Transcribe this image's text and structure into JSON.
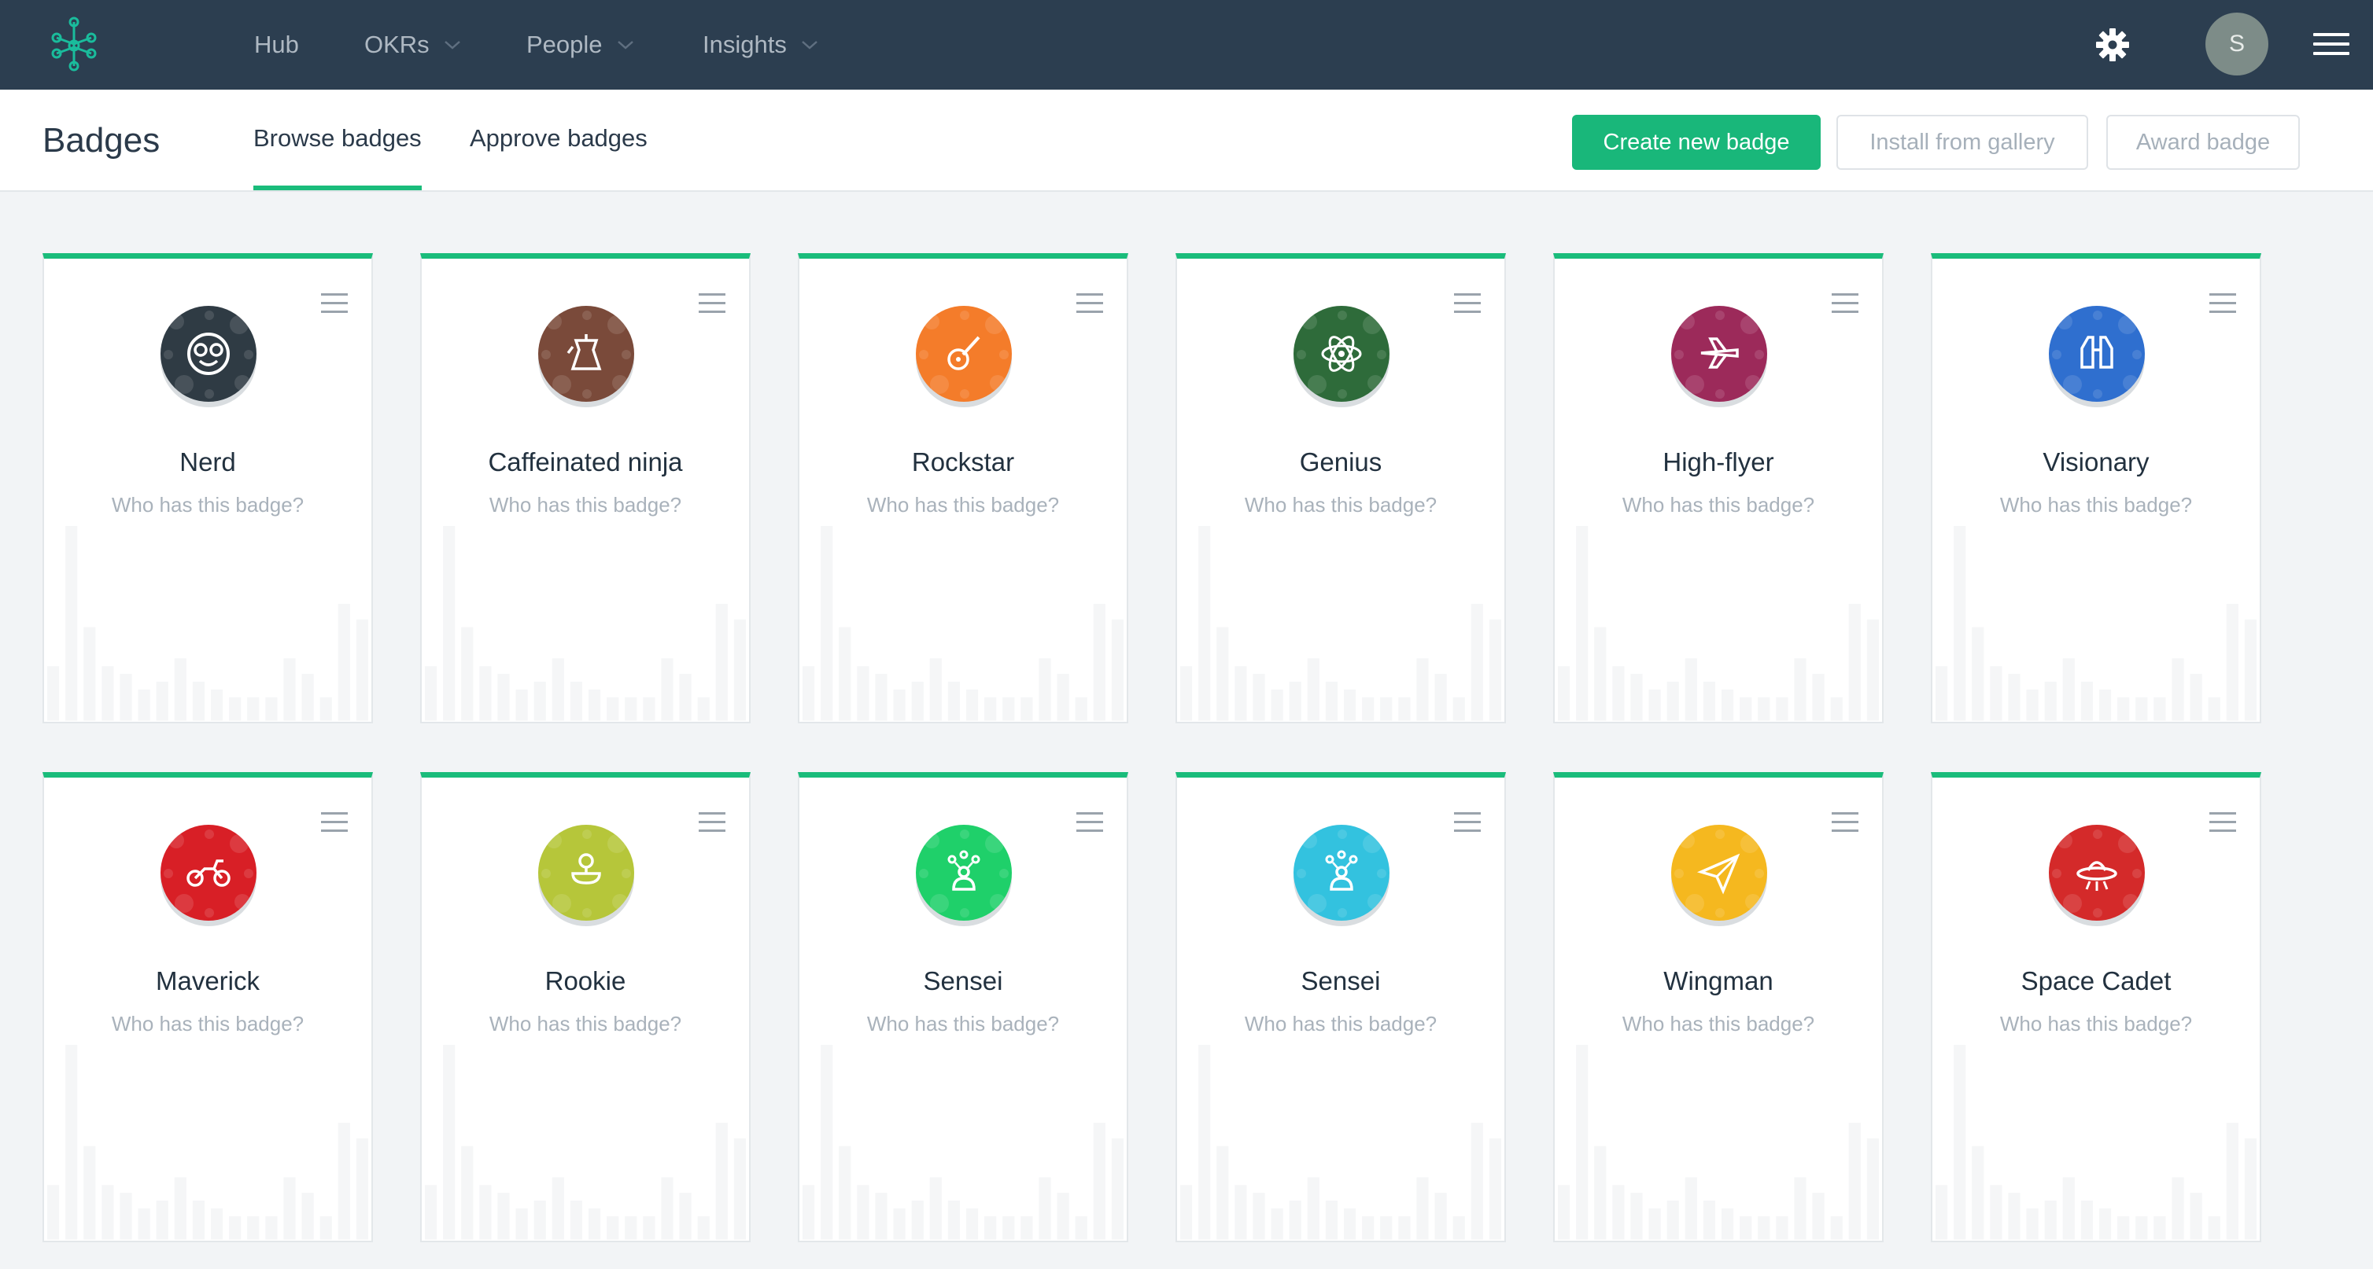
{
  "nav": {
    "items": [
      {
        "label": "Hub",
        "dropdown": false
      },
      {
        "label": "OKRs",
        "dropdown": true
      },
      {
        "label": "People",
        "dropdown": true
      },
      {
        "label": "Insights",
        "dropdown": true
      }
    ],
    "avatar_initial": "S",
    "icons": {
      "logo": "network-logo-icon",
      "settings": "gear-icon",
      "menu": "hamburger-icon"
    }
  },
  "subheader": {
    "title": "Badges",
    "tabs": [
      {
        "label": "Browse badges",
        "active": true
      },
      {
        "label": "Approve badges",
        "active": false
      }
    ],
    "buttons": {
      "create": "Create new badge",
      "install": "Install from gallery",
      "award": "Award badge"
    }
  },
  "colors": {
    "accent": "#1abc7b",
    "nav_bg": "#2c3e50"
  },
  "badges": [
    {
      "name": "Nerd",
      "subtitle": "Who has this badge?",
      "icon": "nerd-face-icon",
      "color": "#2f3b44"
    },
    {
      "name": "Caffeinated ninja",
      "subtitle": "Who has this badge?",
      "icon": "coffee-pot-icon",
      "color": "#7a4a3a"
    },
    {
      "name": "Rockstar",
      "subtitle": "Who has this badge?",
      "icon": "guitar-icon",
      "color": "#f47c2a"
    },
    {
      "name": "Genius",
      "subtitle": "Who has this badge?",
      "icon": "atom-icon",
      "color": "#2e6b3a"
    },
    {
      "name": "High-flyer",
      "subtitle": "Who has this badge?",
      "icon": "airplane-icon",
      "color": "#9c2a5a"
    },
    {
      "name": "Visionary",
      "subtitle": "Who has this badge?",
      "icon": "binoculars-icon",
      "color": "#2f6fcf"
    },
    {
      "name": "Maverick",
      "subtitle": "Who has this badge?",
      "icon": "motorbike-icon",
      "color": "#d81f26"
    },
    {
      "name": "Rookie",
      "subtitle": "Who has this badge?",
      "icon": "pacifier-icon",
      "color": "#b6c63a"
    },
    {
      "name": "Sensei",
      "subtitle": "Who has this badge?",
      "icon": "mentor-icon",
      "color": "#1fd06a"
    },
    {
      "name": "Sensei",
      "subtitle": "Who has this badge?",
      "icon": "mentor-icon",
      "color": "#33c2df"
    },
    {
      "name": "Wingman",
      "subtitle": "Who has this badge?",
      "icon": "paper-plane-icon",
      "color": "#f5b81f"
    },
    {
      "name": "Space Cadet",
      "subtitle": "Who has this badge?",
      "icon": "ufo-icon",
      "color": "#d42a2a"
    }
  ]
}
